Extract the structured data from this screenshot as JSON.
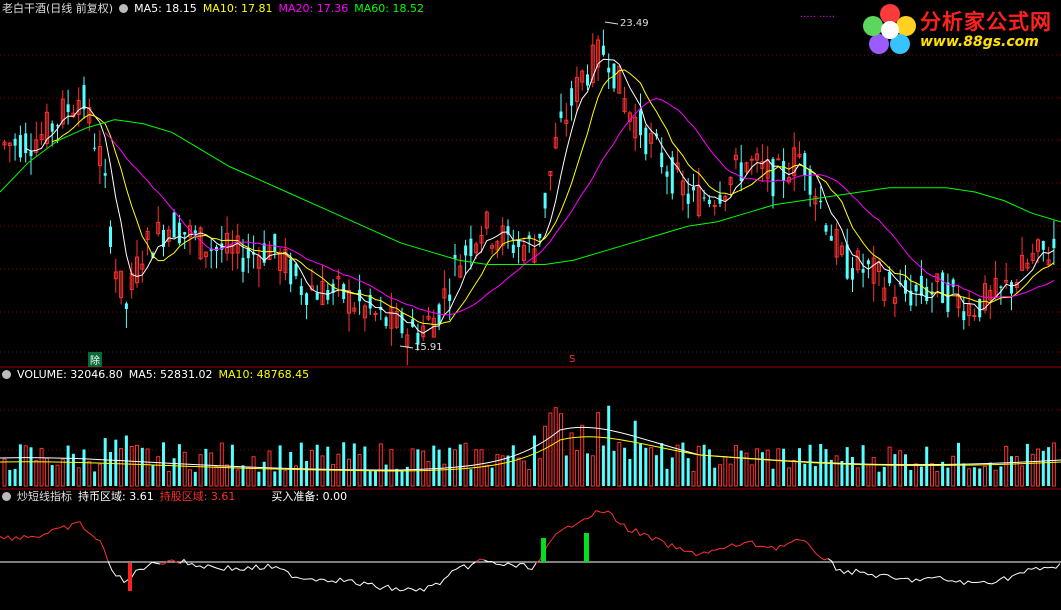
{
  "price_header": {
    "title": "老白干酒(日线 前复权)",
    "ma5": "MA5: 18.15",
    "ma10": "MA10: 17.81",
    "ma20": "MA20: 17.36",
    "ma60": "MA60: 18.52"
  },
  "volume_header": {
    "title": "VOLUME: 32046.80",
    "ma5": "MA5: 52831.02",
    "ma10": "MA10: 48768.45"
  },
  "indicator_header": {
    "title": "炒短线指标",
    "hold_cash": "持币区域: 3.61",
    "hold_stock": "持股区域: 3.61",
    "buy_prepare": "买入准备: 0.00"
  },
  "annotations": {
    "high_label": "23.49",
    "low_label": "15.91",
    "event_label": "除",
    "event_label2": "S"
  },
  "logo": {
    "title": "分析家公式网",
    "url": "www.88gs.com"
  },
  "colors": {
    "up": "#ff3030",
    "down": "#54ffff",
    "ma5": "#ffffff",
    "ma10": "#ffff00",
    "ma20": "#ff00ff",
    "ma60": "#00ff00",
    "grid": "#8b0000"
  },
  "chart_data": [
    {
      "type": "line",
      "title": "老白干酒(日线 前复权)",
      "y_reference": {
        "high": 23.49,
        "low": 15.91
      },
      "series_path_ma20": [
        20.2,
        20.3,
        20.4,
        20.5,
        20.3,
        19.8,
        19.3,
        18.9,
        18.6,
        18.4,
        18.3,
        18.2,
        18.1,
        17.9,
        17.7,
        17.5,
        17.3,
        17.2,
        17.1,
        17.2,
        17.4,
        17.8,
        18.5,
        19.4,
        20.4,
        21.2,
        21.6,
        21.5,
        21.1,
        20.6,
        20.2,
        19.9,
        19.7,
        19.6,
        19.5,
        19.6,
        19.8,
        19.8,
        19.4,
        18.9,
        18.5,
        18.2,
        17.9,
        17.6,
        17.4,
        17.3,
        17.4
      ],
      "series_path_ma60": [
        19.5,
        20.2,
        20.7,
        21.0,
        21.2,
        21.1,
        20.9,
        20.5,
        20.1,
        19.8,
        19.5,
        19.2,
        18.9,
        18.6,
        18.3,
        18.1,
        17.9,
        17.8,
        17.8,
        17.8,
        17.9,
        18.1,
        18.3,
        18.5,
        18.7,
        18.8,
        19.0,
        19.2,
        19.3,
        19.4,
        19.5,
        19.6,
        19.6,
        19.6,
        19.5,
        19.3,
        19.0,
        18.8
      ]
    },
    {
      "type": "bar",
      "title": "VOLUME",
      "values_latest": {
        "volume": 32046.8,
        "ma5": 52831.02,
        "ma10": 48768.45
      }
    },
    {
      "type": "line",
      "title": "炒短线指标",
      "values_latest": {
        "hold_cash": 3.61,
        "hold_stock": 3.61,
        "buy_prepare": 0.0
      }
    }
  ]
}
